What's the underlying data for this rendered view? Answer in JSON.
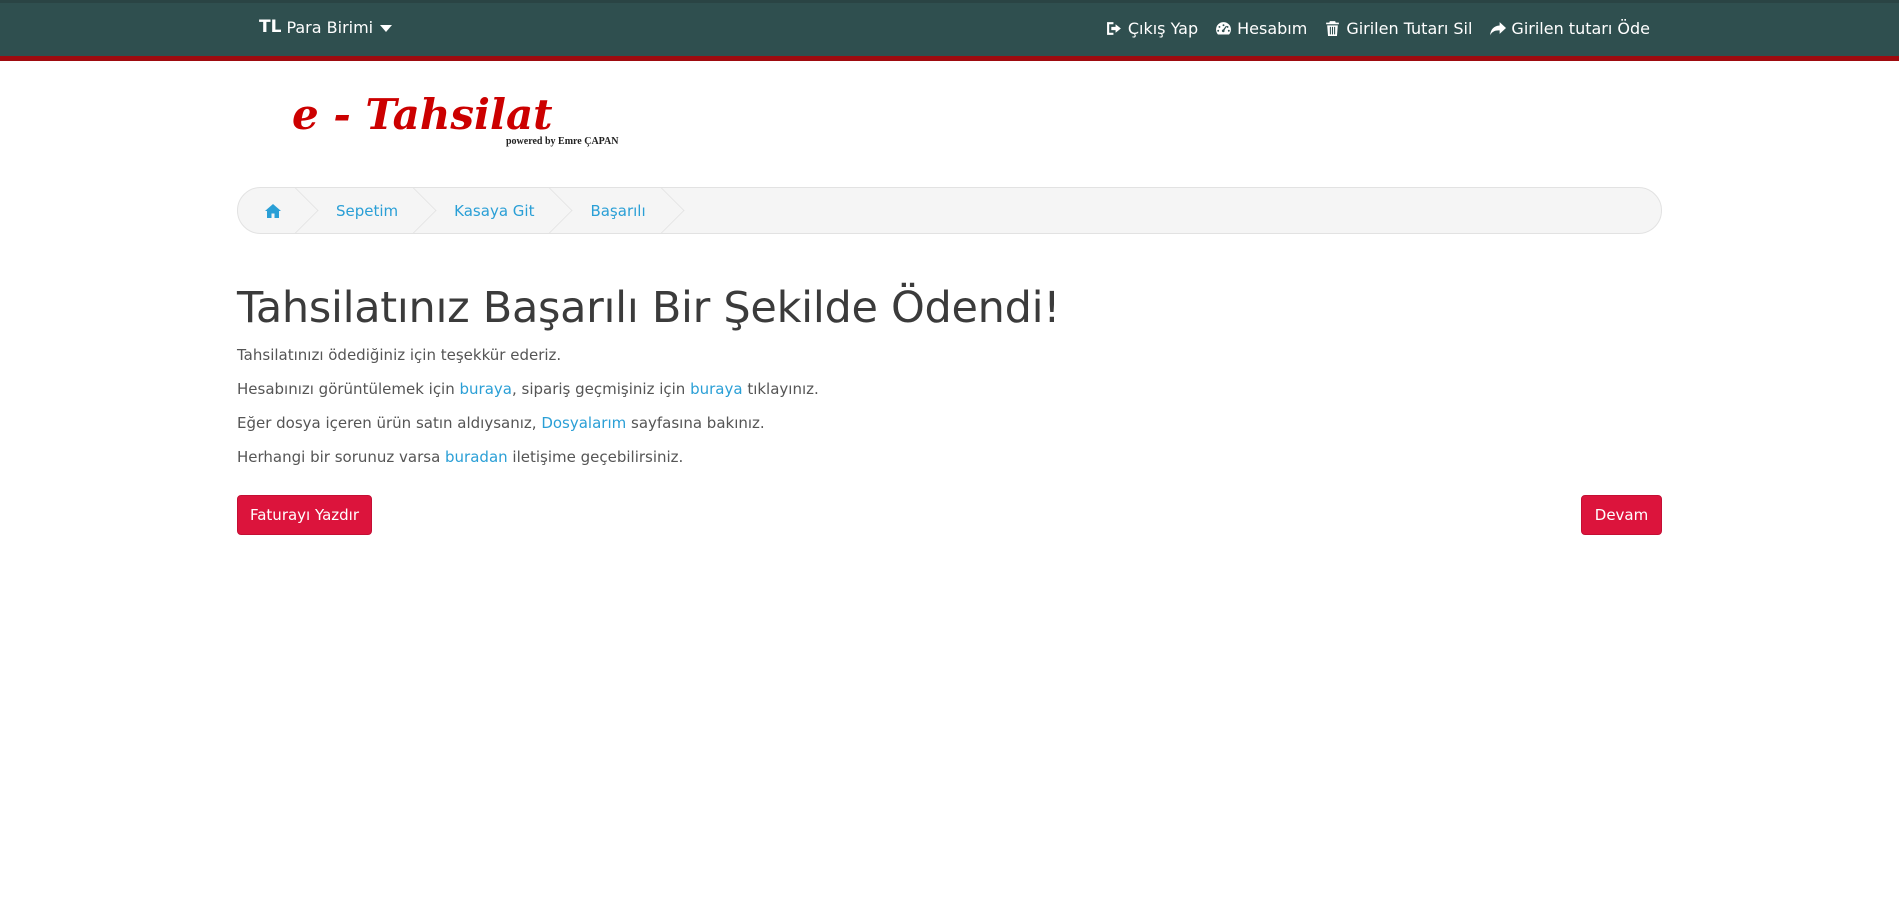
{
  "topbar": {
    "currency_code": "TL",
    "currency_label": "Para Birimi",
    "nav": [
      {
        "label": "Çıkış Yap",
        "icon": "sign-out-icon"
      },
      {
        "label": "Hesabım",
        "icon": "dashboard-icon"
      },
      {
        "label": "Girilen Tutarı Sil",
        "icon": "trash-icon"
      },
      {
        "label": "Girilen tutarı Öde",
        "icon": "share-icon"
      }
    ]
  },
  "logo": {
    "text": "e - Tahsilat",
    "subtext": "powered by Emre ÇAPAN"
  },
  "breadcrumb": {
    "items": [
      "Sepetim",
      "Kasaya Git",
      "Başarılı"
    ]
  },
  "main": {
    "title": "Tahsilatınız Başarılı Bir Şekilde Ödendi!",
    "p1": "Tahsilatınızı ödediğiniz için teşekkür ederiz.",
    "p2": {
      "a": "Hesabınızı görüntülemek için ",
      "link1": "buraya",
      "b": ", sipariş geçmişiniz için ",
      "link2": "buraya",
      "c": " tıklayınız."
    },
    "p3": {
      "a": "Eğer dosya içeren ürün satın aldıysanız, ",
      "link": "Dosyalarım",
      "b": " sayfasına bakınız."
    },
    "p4": {
      "a": "Herhangi bir sorunuz varsa ",
      "link": "buradan",
      "b": " iletişime geçebilirsiniz."
    },
    "print_button": "Faturayı Yazdır",
    "continue_button": "Devam"
  },
  "colors": {
    "topbar": "#2f4f4f",
    "topbar_border": "#9e0b0f",
    "link": "#2a9fd6",
    "button": "#dc143c",
    "logo_red": "#cc0000"
  }
}
